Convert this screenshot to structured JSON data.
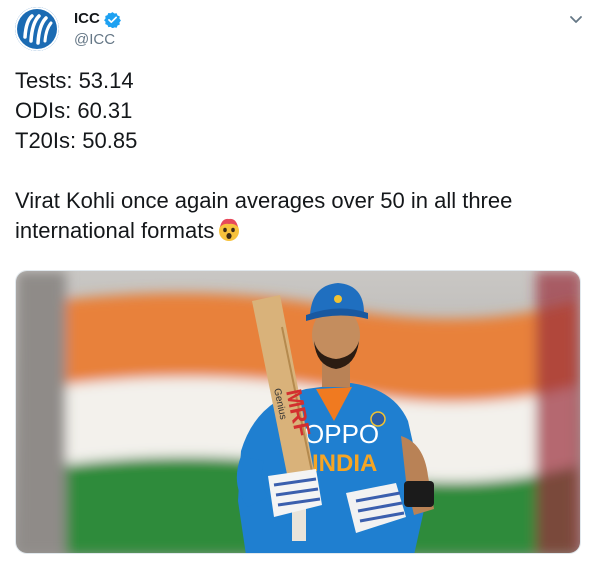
{
  "account": {
    "name": "ICC",
    "handle": "@ICC",
    "avatar_icon": "icc-logo-icon",
    "verified": true
  },
  "tweet": {
    "lines": [
      "Tests: 53.14",
      "ODIs: 60.31",
      "T20Is: 50.85"
    ],
    "message_line_1": "Virat Kohli once again averages over 50 in all three",
    "message_line_2": "international formats",
    "emoji_icon": "exploding-head-emoji-icon"
  },
  "media": {
    "image_icon": "cricketer-raising-bat-photo",
    "jersey_brand": "OPPO",
    "jersey_country": "INDIA",
    "bat_brand": "MRF",
    "bat_model": "Genius"
  },
  "colors": {
    "accent": "#1da1f2",
    "text": "#14171a",
    "secondary_text": "#657786",
    "flag_saffron": "#e8813a",
    "flag_green": "#2f8b3b",
    "jersey_blue": "#1f7fd0"
  }
}
